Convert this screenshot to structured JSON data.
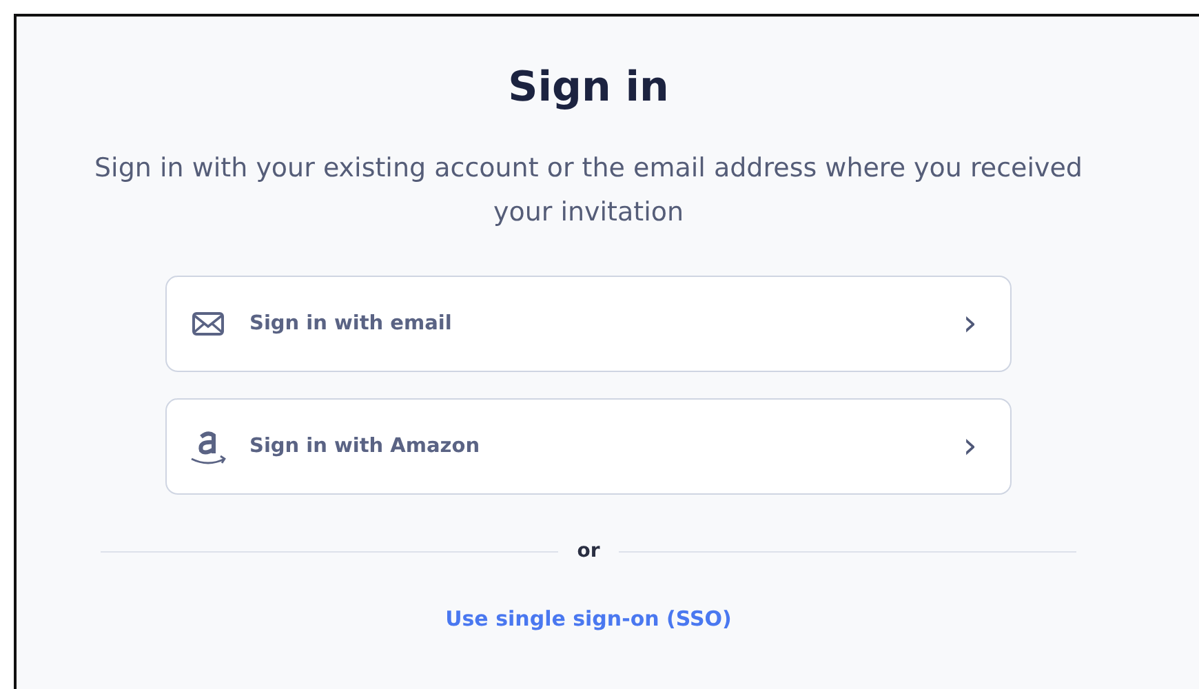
{
  "title": "Sign in",
  "subtitle": "Sign in with your existing account or the email address where you received your invitation",
  "options": [
    {
      "kind": "email",
      "label": "Sign in with email",
      "chevron": "›"
    },
    {
      "kind": "amazon",
      "label": "Sign in with Amazon",
      "chevron": "›"
    }
  ],
  "divider": "or",
  "sso_link": "Use single sign-on (SSO)"
}
